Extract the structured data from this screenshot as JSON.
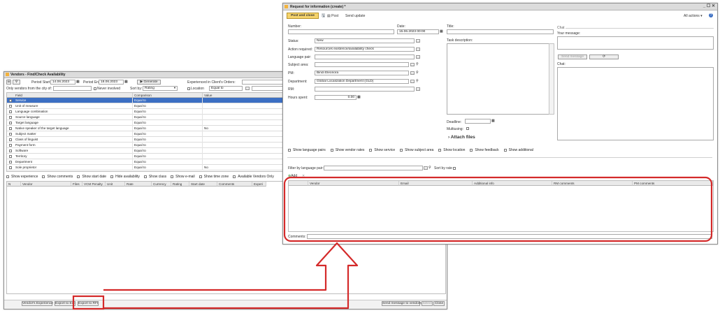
{
  "vendors_window": {
    "title": "Vendors - Find/Check Availability",
    "toolbar": {
      "period_start_label": "Period Start:",
      "period_start_value": "14.06.2023",
      "period_end_label": "Period End:",
      "period_end_value": "18.06.2023",
      "generate_label": "Generate",
      "experienced_label": "Experienced in Client's Orders:",
      "only_vendors_label": "Only vendors from the city of:",
      "never_involved_label": "Never involved",
      "sort_by_label": "Sort by:",
      "sort_by_value": "Rating",
      "location_label": "Location",
      "location_value": "Equal to"
    },
    "criteria_columns": [
      "Field",
      "Comparison",
      "Value"
    ],
    "criteria": [
      {
        "field": "Service",
        "comparison": "Equal to",
        "value": ""
      },
      {
        "field": "Unit of measure",
        "comparison": "Equal to",
        "value": ""
      },
      {
        "field": "Language combination",
        "comparison": "Equal to",
        "value": ""
      },
      {
        "field": "Source language",
        "comparison": "Equal to",
        "value": ""
      },
      {
        "field": "Target language",
        "comparison": "Equal to",
        "value": ""
      },
      {
        "field": "Native speaker of the target language",
        "comparison": "Equal to",
        "value": "No"
      },
      {
        "field": "Subject matter",
        "comparison": "Equal to",
        "value": ""
      },
      {
        "field": "Class of linguist",
        "comparison": "Equal to",
        "value": ""
      },
      {
        "field": "Payment form",
        "comparison": "Equal to",
        "value": ""
      },
      {
        "field": "Software",
        "comparison": "Equal to",
        "value": ""
      },
      {
        "field": "Territory",
        "comparison": "Equal to",
        "value": ""
      },
      {
        "field": "Department",
        "comparison": "Equal to",
        "value": ""
      },
      {
        "field": "Sole proprietor",
        "comparison": "Equal to",
        "value": "No"
      }
    ],
    "show_options": [
      "Show experience",
      "Show comments",
      "Show start date",
      "Hide availability",
      "Show class",
      "Show e-mail",
      "Show time zone",
      "Available Vendors Only"
    ],
    "result_columns": [
      "N",
      "Vendor",
      "Files",
      "VCM Penalty",
      "Unit",
      "Rate",
      "Currency",
      "Rating",
      "Start date",
      "Comments",
      "Experi"
    ],
    "bottom": {
      "vendors_experience": "Vendor's Experience",
      "export_to_excel": "Export to Exc",
      "export_to_rfi": "Export to RFI",
      "send_message": "Send message to vendors",
      "select": "Select",
      "close": "Close"
    }
  },
  "rfi_window": {
    "title": "Request for information (create) *",
    "toolbar": {
      "post_and_close": "Post and close",
      "post": "Post",
      "send_update": "Send update",
      "all_actions": "All actions ▾"
    },
    "form": {
      "number_label": "Number:",
      "number_value": "",
      "date_label": "Date:",
      "date_value": "15.06.2023 00:00",
      "title_label": "Title:",
      "status_label": "Status:",
      "status_value": "New",
      "action_required_label": "Action required:",
      "action_required_value": "Resources existence/availability check",
      "language_pair_label": "Language pair:",
      "subject_area_label": "Subject area:",
      "pm_label": "PM:",
      "pm_value": "Bindi Eleonora",
      "department_label": "Department:",
      "department_value": "Global Localization Department (GLD)",
      "rm_label": "RM:",
      "hours_spent_label": "Hours spent:",
      "hours_spent_value": "0.00",
      "task_description_label": "Task description:",
      "deadline_label": "Deadline:",
      "multiuing_label": "Multiusing:",
      "attach_files_label": "Attach files"
    },
    "chat": {
      "section_label": "Chat",
      "your_message_label": "Your message:",
      "send_message_label": "Send message",
      "refresh_icon": "⟳",
      "chat_label": "Chat:"
    },
    "show_options": [
      "Show language pairs",
      "Show vendor rates",
      "Show service",
      "Show subject area",
      "Show location",
      "Show feedback",
      "Show additional"
    ],
    "filter": {
      "filter_label": "Filter by language pair:",
      "sort_by_rate_label": "Sort by rate"
    },
    "table": {
      "add_label": "Add",
      "columns": [
        "Vendor",
        "Email",
        "Additional info",
        "RM comments",
        "PM comments"
      ]
    },
    "comments_label": "Comments:"
  },
  "colors": {
    "annotation_red": "#d42a2a",
    "selection_blue": "#3c6fc3",
    "post_button_yellow": "#f5d36c"
  }
}
